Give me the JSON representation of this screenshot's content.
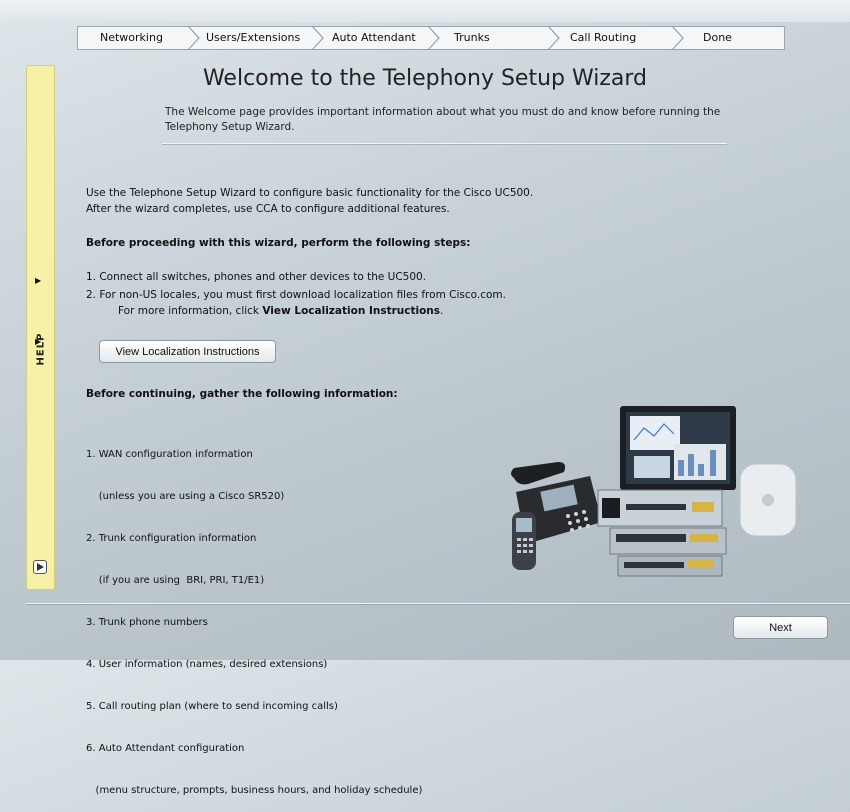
{
  "wizard_steps": [
    "Networking",
    "Users/Extensions",
    "Auto Attendant",
    "Trunks",
    "Call Routing",
    "Done"
  ],
  "help_panel": {
    "label": "HELP"
  },
  "page": {
    "title": "Welcome to the Telephony Setup Wizard",
    "subtitle": "The Welcome page provides important information about what you must do and know before running the Telephony Setup Wizard.",
    "intro_line1": "Use the Telephone Setup Wizard to configure basic functionality for the Cisco UC500.",
    "intro_line2": "After the wizard completes, use CCA to configure additional features.",
    "steps_heading": "Before proceeding with this wizard, perform the following steps:",
    "step1": "1.  Connect all switches, phones and other devices to the UC500.",
    "step2": "2.  For non-US locales, you must first download localization files from Cisco.com.",
    "step2_more_prefix": "For more information, click ",
    "step2_more_link": "View Localization Instructions",
    "step2_more_suffix": ".",
    "view_localization_button": "View Localization Instructions",
    "info_heading": "Before continuing, gather the following information:",
    "info_items": [
      "1. WAN configuration information",
      "    (unless you are using a Cisco SR520)",
      "2. Trunk configuration information",
      "    (if you are using  BRI, PRI, T1/E1)",
      "3. Trunk phone numbers",
      "4. User information (names, desired extensions)",
      "5. Call routing plan (where to send incoming calls)",
      "6. Auto Attendant configuration",
      "   (menu structure, prompts, business hours, and holiday schedule)"
    ]
  },
  "footer": {
    "next_button": "Next"
  }
}
